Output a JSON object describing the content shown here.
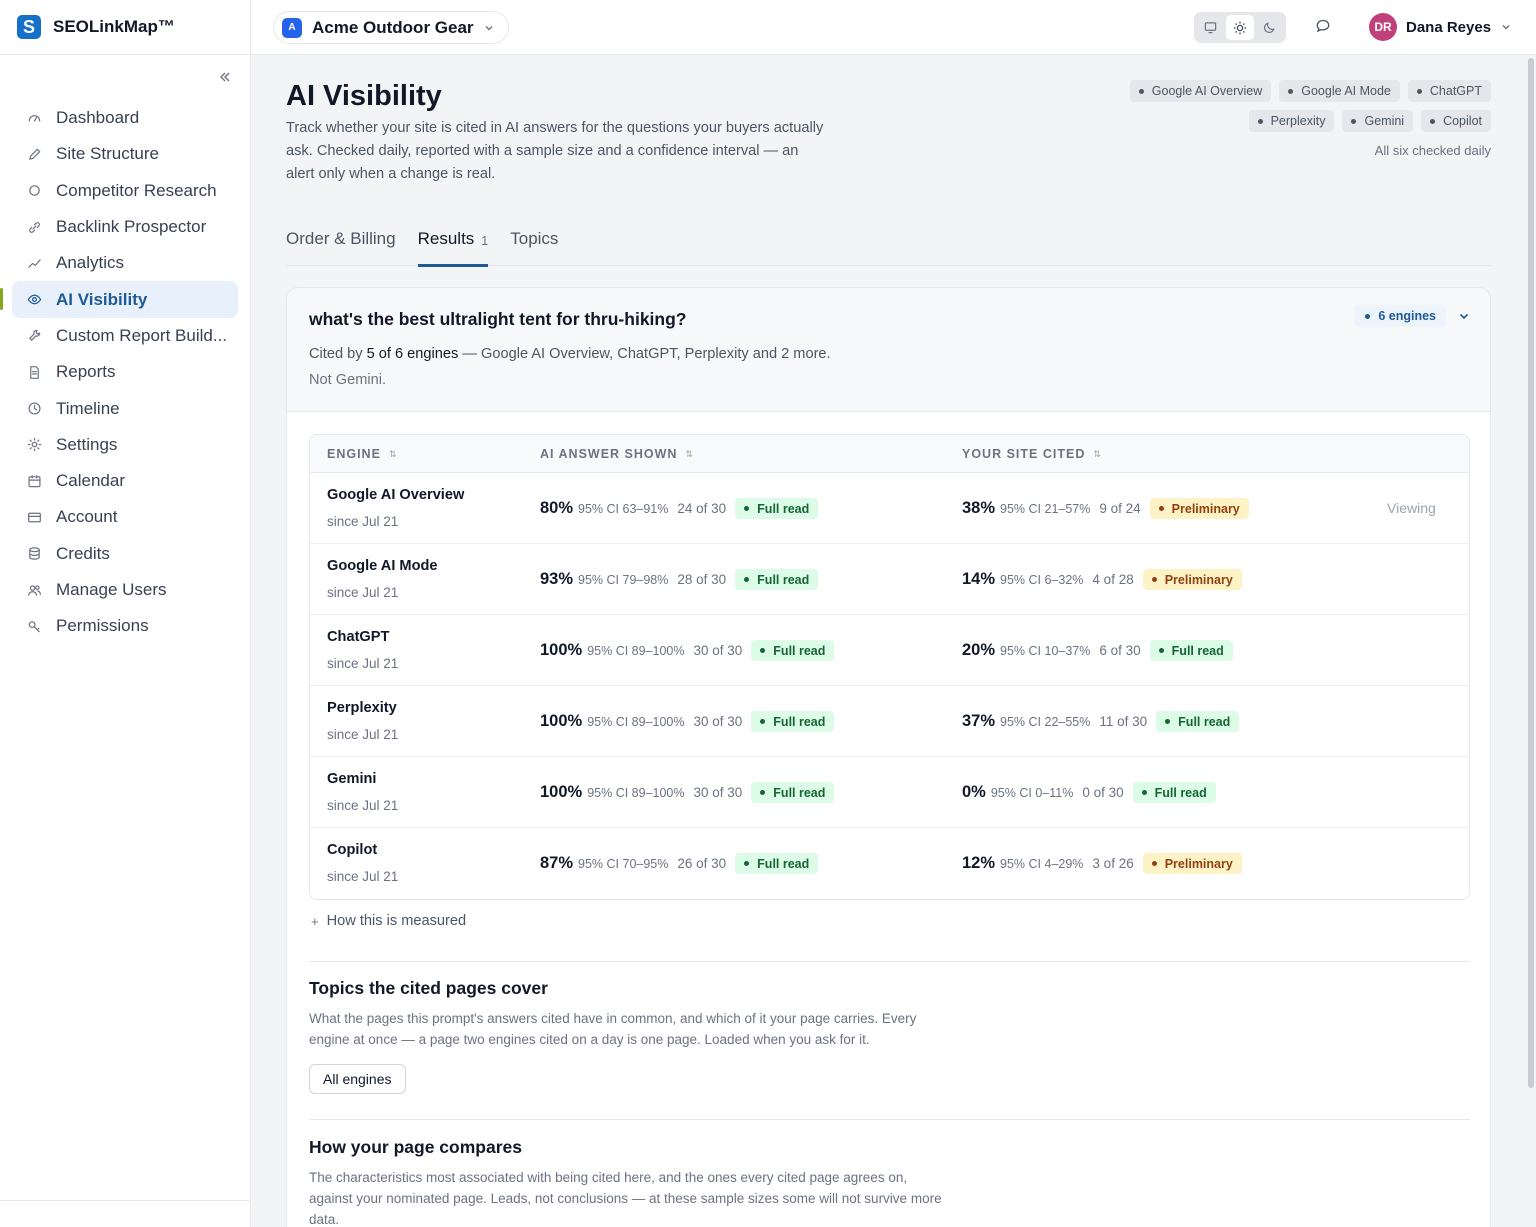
{
  "brand": {
    "name": "SEOLinkMap™",
    "logo_letter": "S"
  },
  "sidebar": {
    "collapse_icon": "double-chevron-left",
    "items": [
      {
        "label": "Dashboard",
        "icon": "gauge"
      },
      {
        "label": "Site Structure",
        "icon": "pencil"
      },
      {
        "label": "Competitor Research",
        "icon": "diamond"
      },
      {
        "label": "Backlink Prospector",
        "icon": "link"
      },
      {
        "label": "Analytics",
        "icon": "trend-line"
      },
      {
        "label": "AI Visibility",
        "icon": "eye",
        "active": true
      },
      {
        "label": "Custom Report Build...",
        "icon": "wrench"
      },
      {
        "label": "Reports",
        "icon": "document"
      },
      {
        "label": "Timeline",
        "icon": "clock"
      },
      {
        "label": "Settings",
        "icon": "sun-gear"
      },
      {
        "label": "Calendar",
        "icon": "calendar"
      },
      {
        "label": "Account",
        "icon": "card"
      },
      {
        "label": "Credits",
        "icon": "database"
      },
      {
        "label": "Manage Users",
        "icon": "users"
      },
      {
        "label": "Permissions",
        "icon": "key"
      }
    ]
  },
  "topbar": {
    "project": {
      "badge": "A",
      "name": "Acme Outdoor Gear"
    },
    "theme_modes": [
      "monitor",
      "sun",
      "moon"
    ],
    "active_theme": "sun",
    "user": {
      "initials": "DR",
      "name": "Dana Reyes"
    }
  },
  "page": {
    "title": "AI Visibility",
    "description": "Track whether your site is cited in AI answers for the questions your buyers actually ask. Checked daily, reported with a sample size and a confidence interval — an alert only when a change is real.",
    "engine_chips": [
      "Google AI Overview",
      "Google AI Mode",
      "ChatGPT",
      "Perplexity",
      "Gemini",
      "Copilot"
    ],
    "chips_note": "All six checked daily"
  },
  "tabs": [
    {
      "label": "Order & Billing",
      "count": ""
    },
    {
      "label": "Results",
      "count": "1",
      "active": true
    },
    {
      "label": "Topics",
      "count": ""
    }
  ],
  "prompt": {
    "title": "what's the best ultralight tent for thru-hiking?",
    "engines_pill": "6 engines",
    "cited_prefix": "Cited by ",
    "cited_bold": "5 of 6 engines",
    "cited_suffix": " — Google AI Overview, ChatGPT, Perplexity and 2 more.",
    "not_cited": "Not Gemini."
  },
  "table": {
    "headers": {
      "engine": "ENGINE",
      "shown": "AI ANSWER SHOWN",
      "cited": "YOUR SITE CITED"
    },
    "viewing_label": "Viewing",
    "rows": [
      {
        "engine": "Google AI Overview",
        "since": "since Jul 21",
        "shown": {
          "pct": "80%",
          "ci": "95% CI 63–91%",
          "count": "24 of 30",
          "badge": "Full read",
          "kind": "full"
        },
        "cited": {
          "pct": "38%",
          "ci": "95% CI 21–57%",
          "count": "9 of 24",
          "badge": "Preliminary",
          "kind": "pre"
        },
        "viewing": true
      },
      {
        "engine": "Google AI Mode",
        "since": "since Jul 21",
        "shown": {
          "pct": "93%",
          "ci": "95% CI 79–98%",
          "count": "28 of 30",
          "badge": "Full read",
          "kind": "full"
        },
        "cited": {
          "pct": "14%",
          "ci": "95% CI 6–32%",
          "count": "4 of 28",
          "badge": "Preliminary",
          "kind": "pre"
        }
      },
      {
        "engine": "ChatGPT",
        "since": "since Jul 21",
        "shown": {
          "pct": "100%",
          "ci": "95% CI 89–100%",
          "count": "30 of 30",
          "badge": "Full read",
          "kind": "full"
        },
        "cited": {
          "pct": "20%",
          "ci": "95% CI 10–37%",
          "count": "6 of 30",
          "badge": "Full read",
          "kind": "full"
        }
      },
      {
        "engine": "Perplexity",
        "since": "since Jul 21",
        "shown": {
          "pct": "100%",
          "ci": "95% CI 89–100%",
          "count": "30 of 30",
          "badge": "Full read",
          "kind": "full"
        },
        "cited": {
          "pct": "37%",
          "ci": "95% CI 22–55%",
          "count": "11 of 30",
          "badge": "Full read",
          "kind": "full"
        }
      },
      {
        "engine": "Gemini",
        "since": "since Jul 21",
        "shown": {
          "pct": "100%",
          "ci": "95% CI 89–100%",
          "count": "30 of 30",
          "badge": "Full read",
          "kind": "full"
        },
        "cited": {
          "pct": "0%",
          "ci": "95% CI 0–11%",
          "count": "0 of 30",
          "badge": "Full read",
          "kind": "full"
        }
      },
      {
        "engine": "Copilot",
        "since": "since Jul 21",
        "shown": {
          "pct": "87%",
          "ci": "95% CI 70–95%",
          "count": "26 of 30",
          "badge": "Full read",
          "kind": "full"
        },
        "cited": {
          "pct": "12%",
          "ci": "95% CI 4–29%",
          "count": "3 of 26",
          "badge": "Preliminary",
          "kind": "pre"
        }
      }
    ]
  },
  "how_measured": "How this is measured",
  "topics_section": {
    "title": "Topics the cited pages cover",
    "description": "What the pages this prompt's answers cited have in common, and which of it your page carries. Every engine at once — a page two engines cited on a day is one page. Loaded when you ask for it.",
    "button": "All engines"
  },
  "compare_section": {
    "title": "How your page compares",
    "description": "The characteristics most associated with being cited here, and the ones every cited page agrees on, against your nominated page. Leads, not conclusions — at these sample sizes some will not survive more data."
  }
}
